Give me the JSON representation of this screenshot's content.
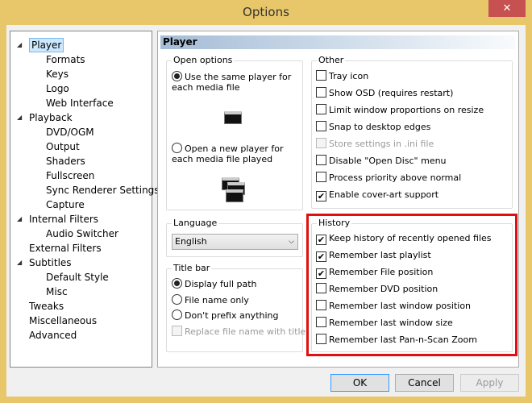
{
  "window": {
    "title": "Options",
    "close": "✕"
  },
  "tree": [
    {
      "label": "Player",
      "level": 0,
      "expanded": true,
      "selected": true
    },
    {
      "label": "Formats",
      "level": 1
    },
    {
      "label": "Keys",
      "level": 1
    },
    {
      "label": "Logo",
      "level": 1
    },
    {
      "label": "Web Interface",
      "level": 1
    },
    {
      "label": "Playback",
      "level": 0,
      "expanded": true
    },
    {
      "label": "DVD/OGM",
      "level": 1
    },
    {
      "label": "Output",
      "level": 1
    },
    {
      "label": "Shaders",
      "level": 1
    },
    {
      "label": "Fullscreen",
      "level": 1
    },
    {
      "label": "Sync Renderer Settings",
      "level": 1
    },
    {
      "label": "Capture",
      "level": 1
    },
    {
      "label": "Internal Filters",
      "level": 0,
      "expanded": true
    },
    {
      "label": "Audio Switcher",
      "level": 1
    },
    {
      "label": "External Filters",
      "level": 0
    },
    {
      "label": "Subtitles",
      "level": 0,
      "expanded": true
    },
    {
      "label": "Default Style",
      "level": 1
    },
    {
      "label": "Misc",
      "level": 1
    },
    {
      "label": "Tweaks",
      "level": 0
    },
    {
      "label": "Miscellaneous",
      "level": 0
    },
    {
      "label": "Advanced",
      "level": 0
    }
  ],
  "panel": {
    "title": "Player"
  },
  "open_options": {
    "label": "Open options",
    "same_player": "Use the same player for each media file",
    "new_player": "Open a new player for each media file played",
    "selected": "same_player"
  },
  "language": {
    "label": "Language",
    "value": "English"
  },
  "title_bar": {
    "label": "Title bar",
    "options": [
      {
        "label": "Display full path",
        "checked": true
      },
      {
        "label": "File name only",
        "checked": false
      },
      {
        "label": "Don't prefix anything",
        "checked": false
      }
    ],
    "replace": {
      "label": "Replace file name with title",
      "checked": false,
      "disabled": true
    }
  },
  "other": {
    "label": "Other",
    "items": [
      {
        "label": "Tray icon",
        "checked": false
      },
      {
        "label": "Show OSD (requires restart)",
        "checked": false
      },
      {
        "label": "Limit window proportions on resize",
        "checked": false
      },
      {
        "label": "Snap to desktop edges",
        "checked": false
      },
      {
        "label": "Store settings in .ini file",
        "checked": false,
        "disabled": true
      },
      {
        "label": "Disable \"Open Disc\" menu",
        "checked": false
      },
      {
        "label": "Process priority above normal",
        "checked": false
      },
      {
        "label": "Enable cover-art support",
        "checked": true
      }
    ]
  },
  "history": {
    "label": "History",
    "items": [
      {
        "label": "Keep history of recently opened files",
        "checked": true
      },
      {
        "label": "Remember last playlist",
        "checked": true
      },
      {
        "label": "Remember File position",
        "checked": true
      },
      {
        "label": "Remember DVD position",
        "checked": false
      },
      {
        "label": "Remember last window position",
        "checked": false
      },
      {
        "label": "Remember last window size",
        "checked": false
      },
      {
        "label": "Remember last Pan-n-Scan Zoom",
        "checked": false
      }
    ]
  },
  "highlight_color": "#e01010",
  "buttons": {
    "ok": "OK",
    "cancel": "Cancel",
    "apply": "Apply"
  }
}
